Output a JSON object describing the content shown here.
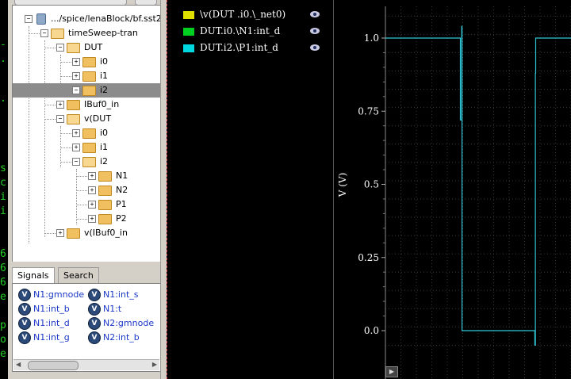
{
  "terminal": {
    "glyphs": [
      "-",
      ".",
      ".",
      "s",
      "c",
      "i",
      "i",
      "6",
      "6",
      "6",
      "e",
      "p",
      "o",
      "e"
    ]
  },
  "tree": {
    "rows": [
      {
        "label": ".../spice/lenaBlock/bf.sst2",
        "icon": "database-icon"
      },
      {
        "label": "timeSweep-tran",
        "icon": "folder-open-icon"
      },
      {
        "label": "DUT",
        "icon": "folder-open-icon"
      },
      {
        "label": "i0",
        "icon": "folder-icon"
      },
      {
        "label": "i1",
        "icon": "folder-icon"
      },
      {
        "label": "i2",
        "icon": "folder-icon"
      },
      {
        "label": "IBuf0_in",
        "icon": "folder-icon"
      },
      {
        "label": "v(DUT",
        "icon": "folder-open-icon"
      },
      {
        "label": "i0",
        "icon": "folder-icon"
      },
      {
        "label": "i1",
        "icon": "folder-icon"
      },
      {
        "label": "i2",
        "icon": "folder-open-icon"
      },
      {
        "label": "N1",
        "icon": "folder-icon"
      },
      {
        "label": "N2",
        "icon": "folder-icon"
      },
      {
        "label": "P1",
        "icon": "folder-icon"
      },
      {
        "label": "P2",
        "icon": "folder-icon"
      },
      {
        "label": "v(IBuf0_in",
        "icon": "folder-icon"
      }
    ]
  },
  "tabs": [
    {
      "label": "Signals",
      "active": true
    },
    {
      "label": "Search",
      "active": false
    }
  ],
  "signals": [
    {
      "label": "N1:gmnode"
    },
    {
      "label": "N1:int_s"
    },
    {
      "label": "N1:int_b"
    },
    {
      "label": "N1:t"
    },
    {
      "label": "N1:int_d"
    },
    {
      "label": "N2:gmnode"
    },
    {
      "label": "N1:int_g"
    },
    {
      "label": "N2:int_b"
    }
  ],
  "signal_icon": "V",
  "legend": [
    {
      "label": "\\v(DUT .i0.\\_net0)",
      "color": "#e0e000"
    },
    {
      "label": "DUT.i0.\\N1:int_d",
      "color": "#00d020"
    },
    {
      "label": "DUT.i2.\\P1:int_d",
      "color": "#00d8e0"
    }
  ],
  "chart_data": {
    "type": "line",
    "ylabel": "V (V)",
    "yticks": [
      "1.0",
      "0.75",
      "0.5",
      "0.25",
      "0.0"
    ],
    "ylim": [
      -0.05,
      1.12
    ],
    "grid": true,
    "series": [
      {
        "name": "DUT.i2.\\P1:int_d",
        "color": "#30c8d8",
        "points": [
          [
            0,
            1.0
          ],
          [
            0.404,
            1.0
          ],
          [
            0.404,
            0.72
          ],
          [
            0.411,
            0.72
          ],
          [
            0.411,
            1.04
          ],
          [
            0.413,
            1.04
          ],
          [
            0.413,
            0.0
          ],
          [
            0.42,
            0.0
          ],
          [
            0.42,
            0.0
          ],
          [
            0.805,
            0.0
          ],
          [
            0.805,
            -0.05
          ],
          [
            0.808,
            -0.05
          ],
          [
            0.808,
            0.88
          ],
          [
            0.81,
            0.88
          ],
          [
            0.81,
            1.0
          ],
          [
            1.0,
            1.0
          ]
        ]
      }
    ]
  },
  "play_icon": "play-icon",
  "play_glyph": "▶"
}
